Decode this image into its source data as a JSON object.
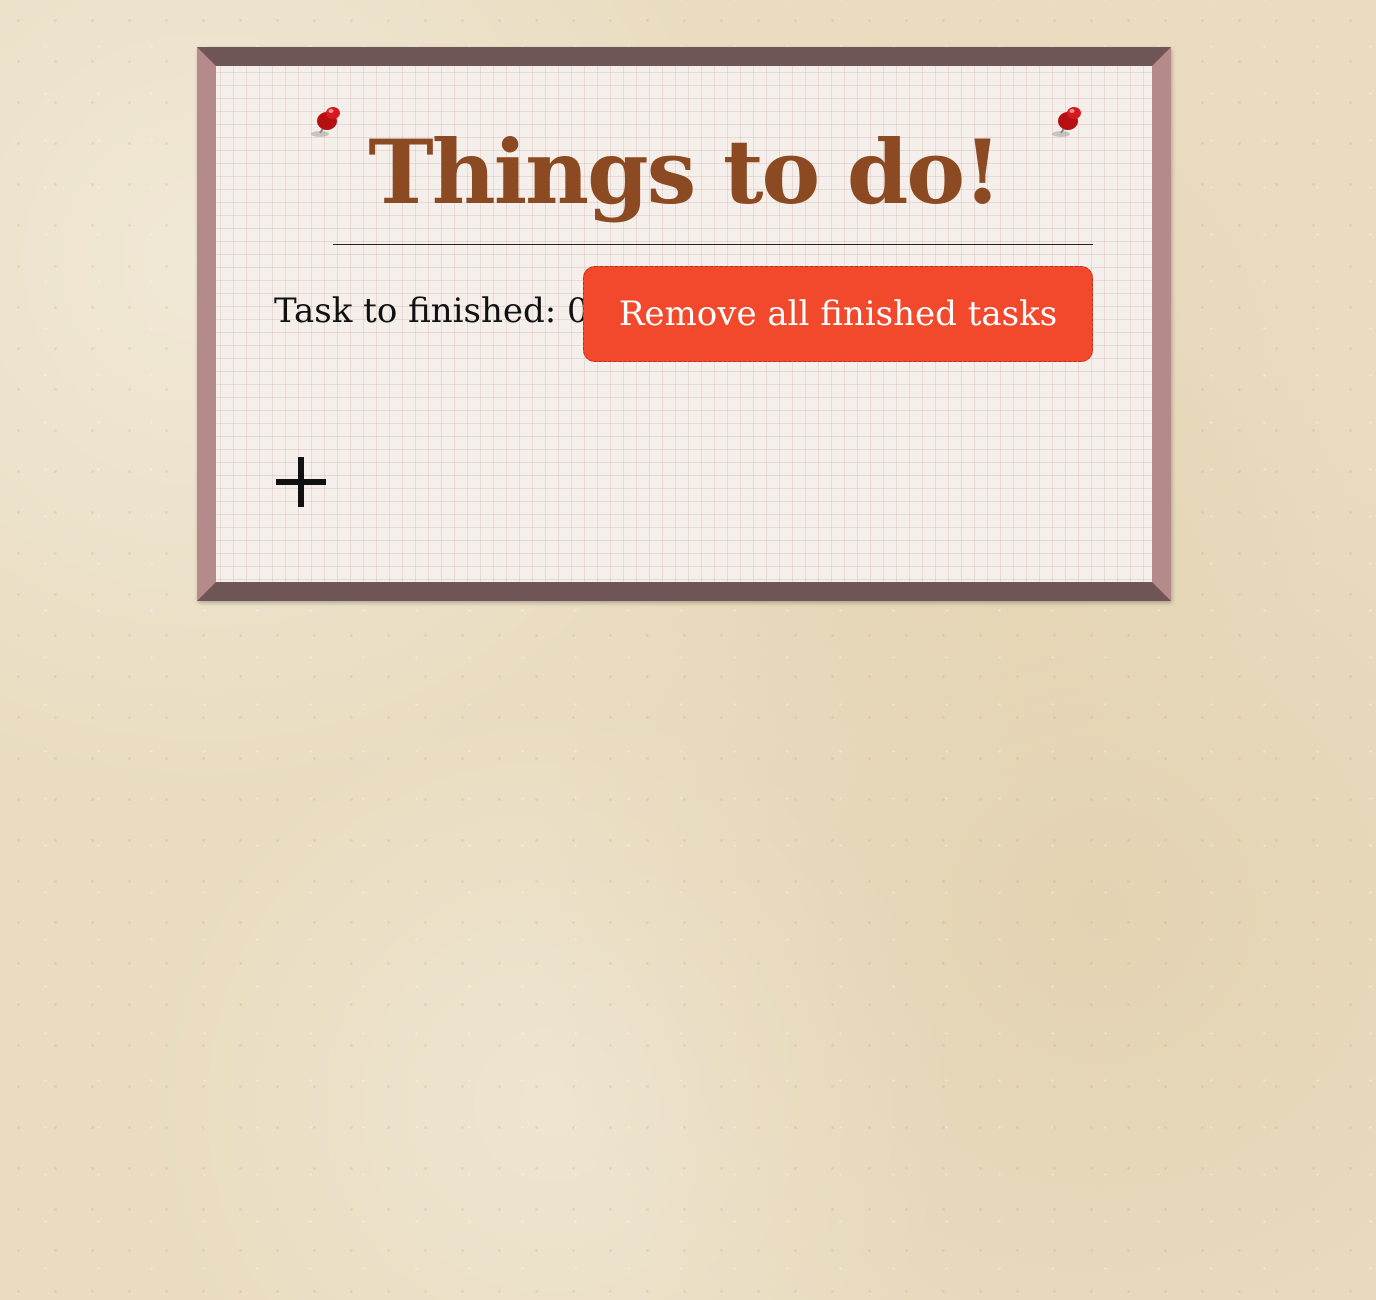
{
  "app": {
    "title": "Things to do!"
  },
  "status": {
    "tasks_to_finish_label": "Task to finished: 0"
  },
  "actions": {
    "remove_finished_label": "Remove all finished tasks",
    "add_task_icon": "plus-icon"
  },
  "decor": {
    "pins": [
      "pushpin-icon",
      "pushpin-icon"
    ]
  },
  "colors": {
    "title": "#8b4a22",
    "remove_button": "#f2482b",
    "frame_dark": "#6f5555",
    "frame_light": "#b48a8a",
    "paper": "#f4efea",
    "background": "#e9dcc0"
  }
}
